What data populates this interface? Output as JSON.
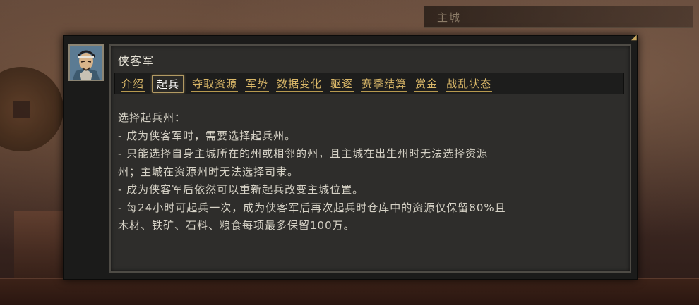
{
  "background": {
    "city_label": "主城"
  },
  "dialog": {
    "portrait_icon": "warrior-portrait-icon",
    "title": "侠客军",
    "tabs": [
      {
        "label": "介绍",
        "active": false
      },
      {
        "label": "起兵",
        "active": true
      },
      {
        "label": "夺取资源",
        "active": false
      },
      {
        "label": "军势",
        "active": false
      },
      {
        "label": "数据变化",
        "active": false
      },
      {
        "label": "驱逐",
        "active": false
      },
      {
        "label": "赛季结算",
        "active": false
      },
      {
        "label": "赏金",
        "active": false
      },
      {
        "label": "战乱状态",
        "active": false
      }
    ],
    "content_lines": [
      "选择起兵州：",
      "- 成为侠客军时，需要选择起兵州。",
      "- 只能选择自身主城所在的州或相邻的州，且主城在出生州时无法选择资源",
      "州；主城在资源州时无法选择司隶。",
      "- 成为侠客军后依然可以重新起兵改变主城位置。",
      "- 每24小时可起兵一次，成为侠客军后再次起兵时仓库中的资源仅保留80%且",
      "木材、铁矿、石料、粮食每项最多保留100万。"
    ]
  },
  "colors": {
    "tab_text": "#d9b768",
    "tab_active_text": "#ffffff",
    "body_text": "#d6d2c6",
    "panel_bg": "#2e2d2b"
  }
}
